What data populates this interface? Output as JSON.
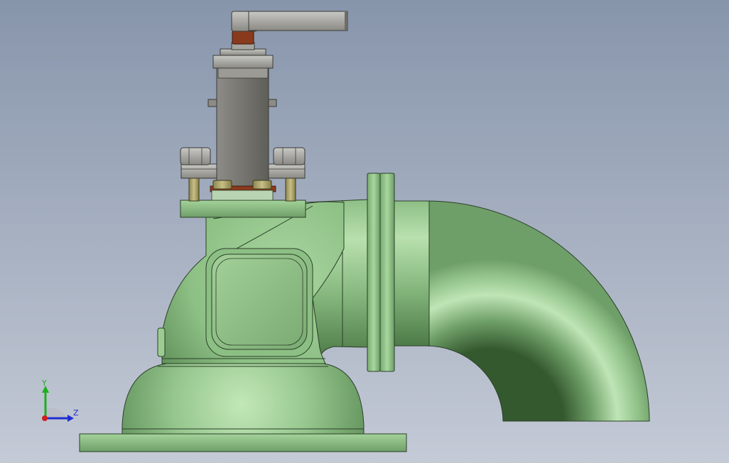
{
  "viewport": {
    "background_top": "#8795ab",
    "background_bottom": "#c4cad6"
  },
  "model": {
    "body_color": "#8fc28a",
    "body_shadow": "#3f6b3d",
    "metal_color": "#7d7c78",
    "brass_color": "#b3a86a",
    "seal_color": "#8a3a1c"
  },
  "triad": {
    "y_label": "Y",
    "z_label": "Z",
    "y_color": "#1fae1f",
    "z_color": "#1f2fd0",
    "x_color": "#d01f1f",
    "icon": "coordinate-triad-icon"
  }
}
